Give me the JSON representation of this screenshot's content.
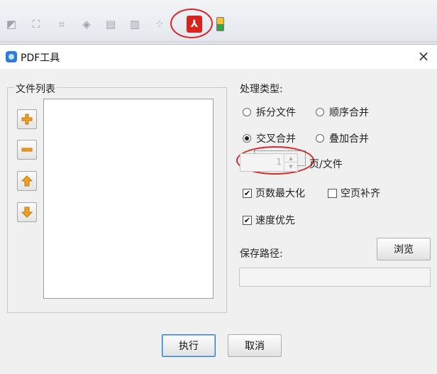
{
  "dialog": {
    "title": "PDF工具",
    "close_glyph": "×"
  },
  "file_list": {
    "legend": "文件列表"
  },
  "process_type": {
    "label": "处理类型:",
    "options": [
      {
        "label": "拆分文件",
        "selected": false
      },
      {
        "label": "顺序合并",
        "selected": false
      },
      {
        "label": "交叉合并",
        "selected": true
      },
      {
        "label": "叠加合并",
        "selected": false
      }
    ]
  },
  "pages_per_file": {
    "value": "1",
    "unit": "页/文件"
  },
  "options": {
    "maximize_pages": {
      "label": "页数最大化",
      "checked": true
    },
    "fill_blank": {
      "label": "空页补齐",
      "checked": false
    },
    "speed_first": {
      "label": "速度优先",
      "checked": true
    },
    "check_glyph": "✔"
  },
  "save_path": {
    "label": "保存路径:",
    "value": "",
    "browse_label": "浏览"
  },
  "footer": {
    "execute_label": "执行",
    "cancel_label": "取消"
  },
  "colors": {
    "highlight_ring": "#d9282a",
    "pdf_icon": "#d9231f",
    "side_button_icon": "#f0a020"
  },
  "icons": {
    "toolbar": [
      "object-icon",
      "select-icon",
      "crop-icon",
      "eraser-icon",
      "barcode-icon",
      "align-icon",
      "grid-icon",
      "pdf-icon",
      "database-icon"
    ],
    "side_buttons": [
      "add-icon",
      "remove-icon",
      "move-up-icon",
      "move-down-icon"
    ]
  }
}
